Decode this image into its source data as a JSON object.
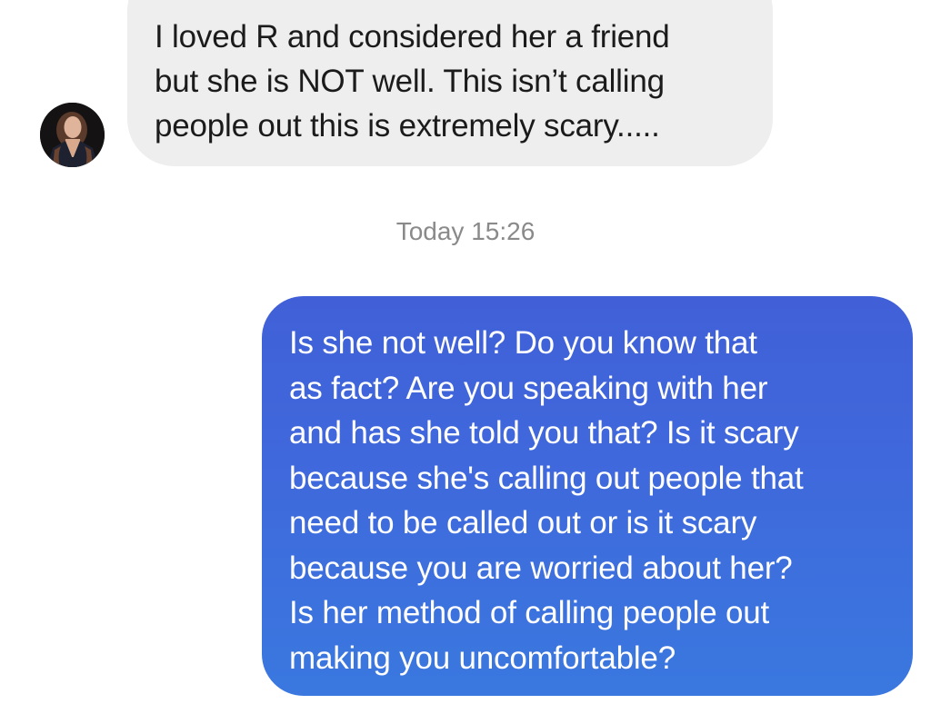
{
  "incoming_message": {
    "lines": [
      "I loved R and considered her a friend",
      "but she is NOT well. This isn’t calling",
      "people out this is extremely scary....."
    ]
  },
  "timestamp": "Today 15:26",
  "outgoing_message": {
    "lines": [
      "Is she not well? Do you know that",
      "as fact? Are you speaking with her",
      "and has she told you that? Is it scary",
      "because she's calling out people that",
      "need to be called out or is it scary",
      "because you are worried about her?",
      "Is her method of calling people out",
      "making you uncomfortable?"
    ]
  },
  "colors": {
    "incoming_bubble": "#eeeeee",
    "outgoing_bubble_top": "#4160d8",
    "outgoing_bubble_bottom": "#3a78df",
    "timestamp_text": "#8a8a8a"
  }
}
